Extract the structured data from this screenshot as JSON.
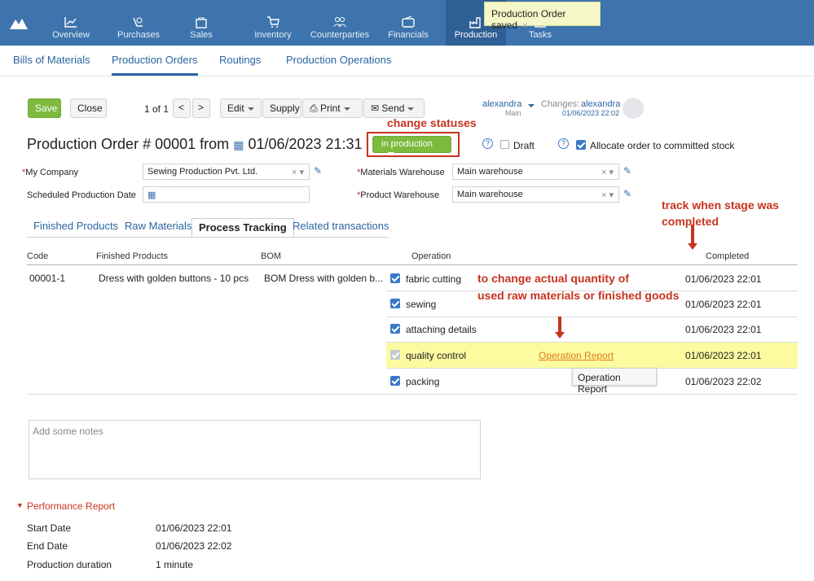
{
  "nav": {
    "items": [
      {
        "label": "Overview"
      },
      {
        "label": "Purchases"
      },
      {
        "label": "Sales"
      },
      {
        "label": "Inventory"
      },
      {
        "label": "Counterparties"
      },
      {
        "label": "Financials"
      },
      {
        "label": "Production"
      },
      {
        "label": "Tasks"
      }
    ],
    "active": "Production"
  },
  "toast": {
    "text": "Production Order saved",
    "close": "×"
  },
  "subnav": {
    "items": [
      {
        "label": "Bills of Materials"
      },
      {
        "label": "Production Orders"
      },
      {
        "label": "Routings"
      },
      {
        "label": "Production Operations"
      }
    ]
  },
  "toolbar": {
    "save": "Save",
    "close": "Close",
    "pager": "1 of 1",
    "prev": "<",
    "next": ">",
    "edit": "Edit",
    "supply": "Supply",
    "print": "Print",
    "send": "Send"
  },
  "user": {
    "name": "alexandra",
    "dept": "Main",
    "changes_label": "Changes:",
    "changes_user": "alexandra",
    "changes_time": "01/06/2023 22:02"
  },
  "title": {
    "prefix": "Production Order #",
    "number": "00001",
    "from": "from",
    "date": "01/06/2023 21:31"
  },
  "status": {
    "label": "in production"
  },
  "draft": {
    "label": "Draft"
  },
  "allocate": {
    "label": "Allocate order to committed stock"
  },
  "form": {
    "company_label": "My Company",
    "company": "Sewing Production Pvt. Ltd.",
    "sched_label": "Scheduled Production Date",
    "mat_wh_label": "Materials Warehouse",
    "mat_wh": "Main warehouse",
    "prod_wh_label": "Product Warehouse",
    "prod_wh": "Main warehouse"
  },
  "tabs": [
    {
      "label": "Finished Products"
    },
    {
      "label": "Raw Materials"
    },
    {
      "label": "Process Tracking"
    },
    {
      "label": "Related transactions"
    }
  ],
  "table": {
    "headers": {
      "code": "Code",
      "finished": "Finished Products",
      "bom": "BOM",
      "operation": "Operation",
      "completed": "Completed"
    },
    "code": "00001-1",
    "finished": "Dress with golden buttons - 10 pcs",
    "bom": "BOM Dress with golden b...",
    "ops": [
      {
        "name": "fabric cutting",
        "completed": "01/06/2023 22:01"
      },
      {
        "name": "sewing",
        "completed": "01/06/2023 22:01"
      },
      {
        "name": "attaching details",
        "completed": "01/06/2023 22:01"
      },
      {
        "name": "quality control",
        "completed": "01/06/2023 22:01",
        "link": "Operation Report"
      },
      {
        "name": "packing",
        "completed": "01/06/2023 22:02"
      }
    ]
  },
  "tooltip": "Operation Report",
  "notes": {
    "placeholder": "Add some notes"
  },
  "annotations": {
    "statuses": "change statuses",
    "track1": "track when stage was",
    "track2": "completed",
    "qty1": "to change actual quantity of",
    "qty2": "used raw materials or finished goods"
  },
  "report": {
    "title": "Performance Report",
    "start_label": "Start Date",
    "start": "01/06/2023 22:01",
    "end_label": "End Date",
    "end": "01/06/2023 22:02",
    "dur_label": "Production duration",
    "dur": "1 minute"
  },
  "colors": {
    "topbar": "#3d74ad",
    "accent": "#2b64a1",
    "green": "#7dba3e",
    "annotation": "#c8321f",
    "highlight": "#fdfba0"
  }
}
